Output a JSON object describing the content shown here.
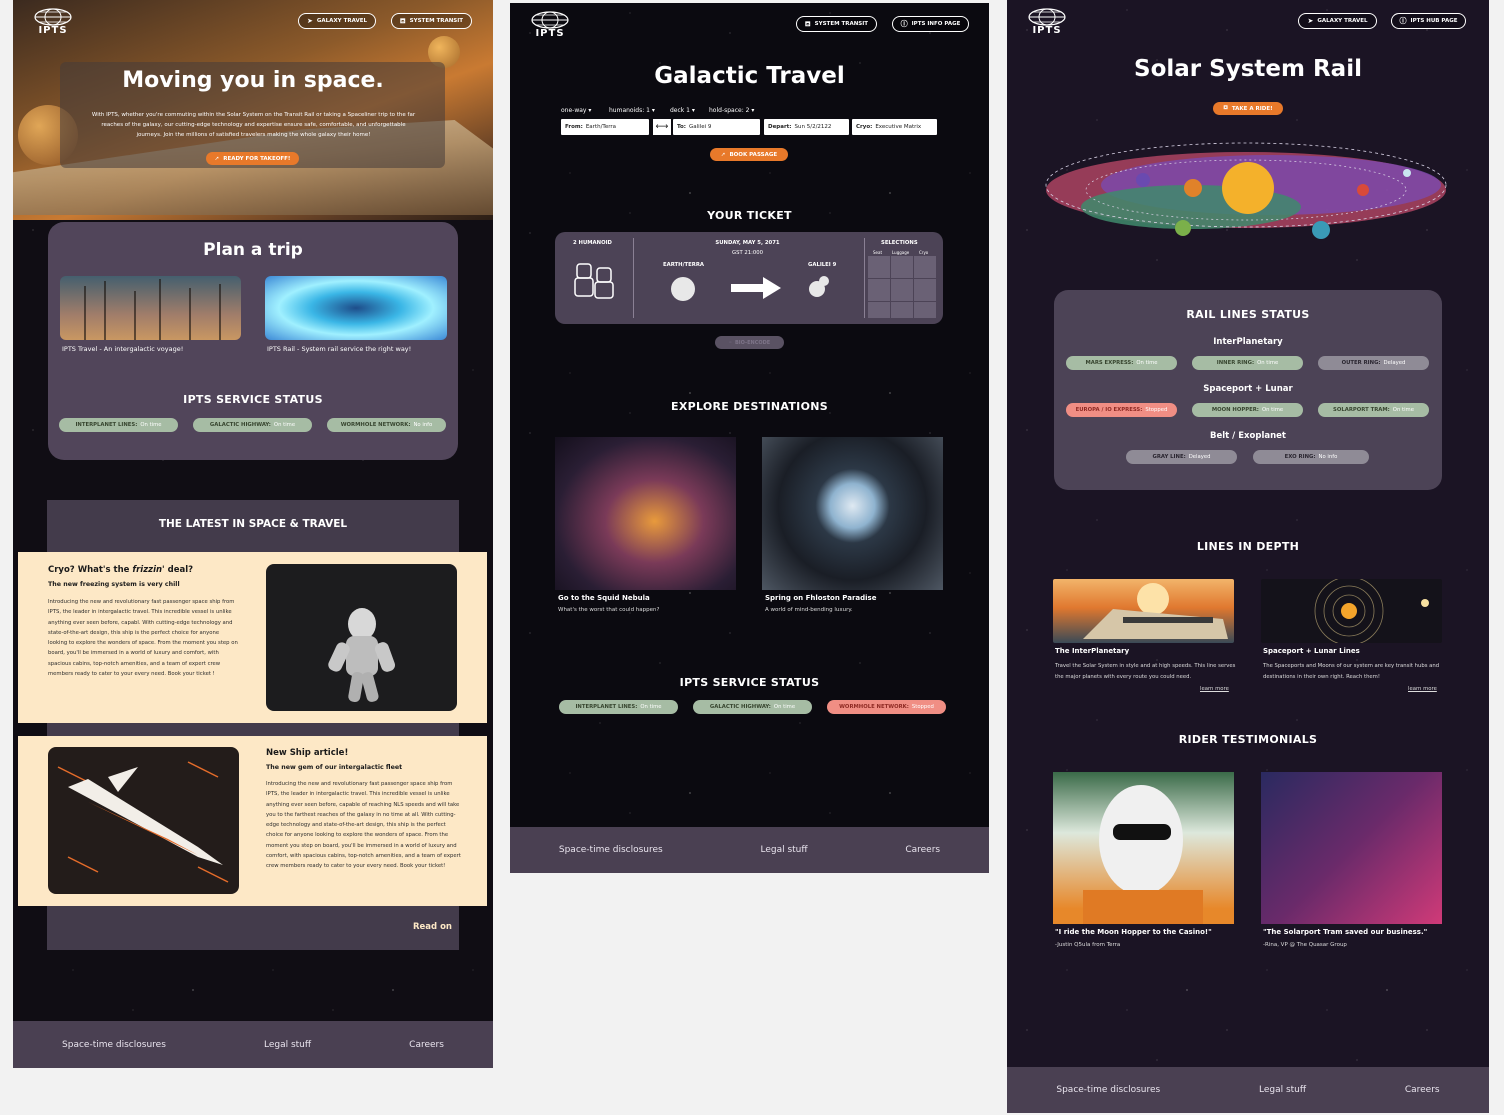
{
  "brand": {
    "logo_text": "IPTS"
  },
  "panel1": {
    "nav": [
      "GALAXY TRAVEL",
      "SYSTEM TRANSIT"
    ],
    "hero": {
      "title": "Moving you in space.",
      "description": "With IPTS, whether you're commuting within the Solar System on the Transit Rail or taking a Spaceliner trip to the far reaches of the galaxy, our cutting-edge technology and expertise ensure safe, comfortable, and unforgettable journeys. Join the millions of satisfied travelers making the whole galaxy their home!",
      "cta": "READY FOR TAKEOFF!"
    },
    "plan": {
      "title": "Plan a trip",
      "cards": [
        {
          "caption": "IPTS Travel - An intergalactic voyage!"
        },
        {
          "caption": "IPTS Rail - System rail service the right way!"
        }
      ]
    },
    "status": {
      "title": "IPTS SERVICE STATUS",
      "items": [
        {
          "name": "INTERPLANET LINES:",
          "value": "On time"
        },
        {
          "name": "GALACTIC HIGHWAY:",
          "value": "On time"
        },
        {
          "name": "WORMHOLE NETWORK:",
          "value": "No info"
        }
      ]
    },
    "news": {
      "title": "THE LATEST IN SPACE & TRAVEL",
      "articles": [
        {
          "title_a": "Cryo? What's the ",
          "title_b": "frizzin'",
          "title_c": " deal?",
          "subtitle": "The new freezing system is very chill",
          "body": "Introducing the new and revolutionary fast passenger space ship from IPTS, the leader in intergalactic travel. This incredible vessel is unlike anything ever seen before, capabl. With cutting-edge technology and state-of-the-art design, this ship is the perfect choice for anyone looking to explore the wonders of space. From the moment you step on board, you'll be immersed in a world of luxury and comfort, with spacious cabins, top-notch amenities, and a team of expert crew members ready to cater to your every need. Book your ticket !"
        },
        {
          "title": "New Ship article!",
          "subtitle": "The new gem of our intergalactic fleet",
          "body": "Introducing the new and revolutionary fast passenger space ship from IPTS, the leader in intergalactic travel. This incredible vessel is unlike anything ever seen before, capable of reaching NLS speeds and will take you to the farthest reaches of the galaxy in no time at all. With cutting-edge technology and state-of-the-art design, this ship is the perfect choice for anyone looking to explore the wonders of space. From the moment you step on board, you'll be immersed in a world of luxury and comfort, with spacious cabins, top-notch amenities, and a team of expert crew members ready to cater to your every need. Book your ticket!"
        }
      ],
      "read_on": "Read on"
    },
    "footer": [
      "Space-time disclosures",
      "Legal stuff",
      "Careers"
    ]
  },
  "panel2": {
    "nav": [
      "SYSTEM TRANSIT",
      "IPTS INFO PAGE"
    ],
    "title": "Galactic Travel",
    "dropdowns": [
      "one-way",
      "humanoids: 1",
      "deck 1",
      "hold-space: 2"
    ],
    "fields": {
      "from_label": "From:",
      "from_value": "Earth/Terra",
      "swap": "⟷",
      "to_label": "To:",
      "to_value": "Galilei 9",
      "depart_label": "Depart:",
      "depart_value": "Sun 5/2/2122",
      "cryo_label": "Cryo:",
      "cryo_value": "Executive Matrix"
    },
    "book_btn": "BOOK PASSAGE",
    "ticket": {
      "title": "YOUR TICKET",
      "humanoids": "2 HUMANOID",
      "date": "SUNDAY, MAY 5, 2071",
      "time": "GST 21:000",
      "origin": "EARTH/TERRA",
      "dest": "GALILEI 9",
      "selections": "SELECTIONS",
      "sel_cols": [
        "Seat",
        "Luggage",
        "Cryo"
      ],
      "bio_encode": "BIO-ENCODE"
    },
    "explore": {
      "title": "EXPLORE DESTINATIONS",
      "items": [
        {
          "title": "Go to the Squid Nebula",
          "sub": "What's the worst that could happen?"
        },
        {
          "title": "Spring on Fhloston Paradise",
          "sub": "A world of mind-bending luxury."
        }
      ]
    },
    "status": {
      "title": "IPTS SERVICE STATUS",
      "items": [
        {
          "name": "INTERPLANET LINES:",
          "value": "On time"
        },
        {
          "name": "GALACTIC HIGHWAY:",
          "value": "On time"
        },
        {
          "name": "WORMHOLE NETWORK:",
          "value": "Stopped"
        }
      ]
    },
    "footer": [
      "Space-time disclosures",
      "Legal stuff",
      "Careers"
    ]
  },
  "panel3": {
    "nav": [
      "GALAXY TRAVEL",
      "IPTS HUB PAGE"
    ],
    "title": "Solar System Rail",
    "cta": "TAKE A RIDE!",
    "rail": {
      "title": "RAIL LINES STATUS",
      "groups": [
        {
          "name": "InterPlanetary",
          "items": [
            {
              "name": "MARS EXPRESS:",
              "value": "On time"
            },
            {
              "name": "INNER RING:",
              "value": "On time"
            },
            {
              "name": "OUTER RING:",
              "value": "Delayed"
            }
          ]
        },
        {
          "name": "Spaceport + Lunar",
          "items": [
            {
              "name": "EUROPA / IO EXPRESS:",
              "value": "Stopped"
            },
            {
              "name": "MOON HOPPER:",
              "value": "On time"
            },
            {
              "name": "SOLARPORT TRAM:",
              "value": "On time"
            }
          ]
        },
        {
          "name": "Belt / Exoplanet",
          "items": [
            {
              "name": "GRAY LINE:",
              "value": "Delayed"
            },
            {
              "name": "EXO RING:",
              "value": "No info"
            }
          ]
        }
      ]
    },
    "depth": {
      "title": "LINES IN DEPTH",
      "items": [
        {
          "title": "The InterPlanetary",
          "body": "Travel the Solar System in style and at high speeds. This line serves the major planets with every route you could need.",
          "link": "learn more"
        },
        {
          "title": "Spaceport + Lunar Lines",
          "body": "The Spaceports and Moons of our system are key transit hubs and destinations in their own right. Reach them!",
          "link": "learn more"
        }
      ]
    },
    "testimonials": {
      "title": "RIDER TESTIMONIALS",
      "items": [
        {
          "quote": "\"I ride the Moon Hopper to the Casino!\"",
          "by": "-Justin Q5ula from Terra"
        },
        {
          "quote": "\"The Solarport Tram saved our business.\"",
          "by": "-Rina, VP @ The Quasar Group"
        }
      ]
    },
    "footer": [
      "Space-time disclosures",
      "Legal stuff",
      "Careers"
    ]
  },
  "colors": {
    "accent": "#e8792a",
    "card": "#51455a",
    "footer": "#4a4052",
    "pill_ok": "#a6bca4",
    "pill_bad": "#f08e84",
    "article_bg": "#fde8c6"
  }
}
